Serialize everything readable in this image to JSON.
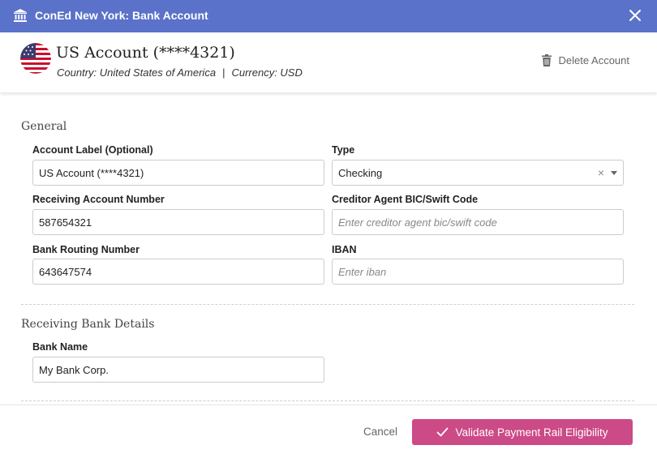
{
  "window": {
    "title": "ConEd New York: Bank Account"
  },
  "header": {
    "account_title": "US Account (****4321)",
    "country": "Country: United States of America",
    "separator": "|",
    "currency": "Currency: USD",
    "delete_label": "Delete Account"
  },
  "general": {
    "section_title": "General",
    "account_label": {
      "label": "Account Label (Optional)",
      "value": "US Account (****4321)"
    },
    "type": {
      "label": "Type",
      "value": "Checking",
      "clear_glyph": "×"
    },
    "receiving_account_number": {
      "label": "Receiving Account Number",
      "value": "587654321"
    },
    "creditor_bic": {
      "label": "Creditor Agent BIC/Swift Code",
      "value": "",
      "placeholder": "Enter creditor agent bic/swift code"
    },
    "bank_routing_number": {
      "label": "Bank Routing Number",
      "value": "643647574"
    },
    "iban": {
      "label": "IBAN",
      "value": "",
      "placeholder": "Enter iban"
    }
  },
  "receiving_bank": {
    "section_title": "Receiving Bank Details",
    "bank_name": {
      "label": "Bank Name",
      "value": "My Bank Corp."
    }
  },
  "footer": {
    "cancel_label": "Cancel",
    "validate_label": "Validate Payment Rail Eligibility"
  },
  "colors": {
    "titlebar": "#5a72c9",
    "primary_button": "#cc4a86"
  },
  "icons": {
    "title_icon": "bank-icon",
    "close_icon": "close-icon",
    "flag": "us-flag-icon",
    "delete_icon": "trash-icon",
    "validate_icon": "checkmark-icon"
  }
}
